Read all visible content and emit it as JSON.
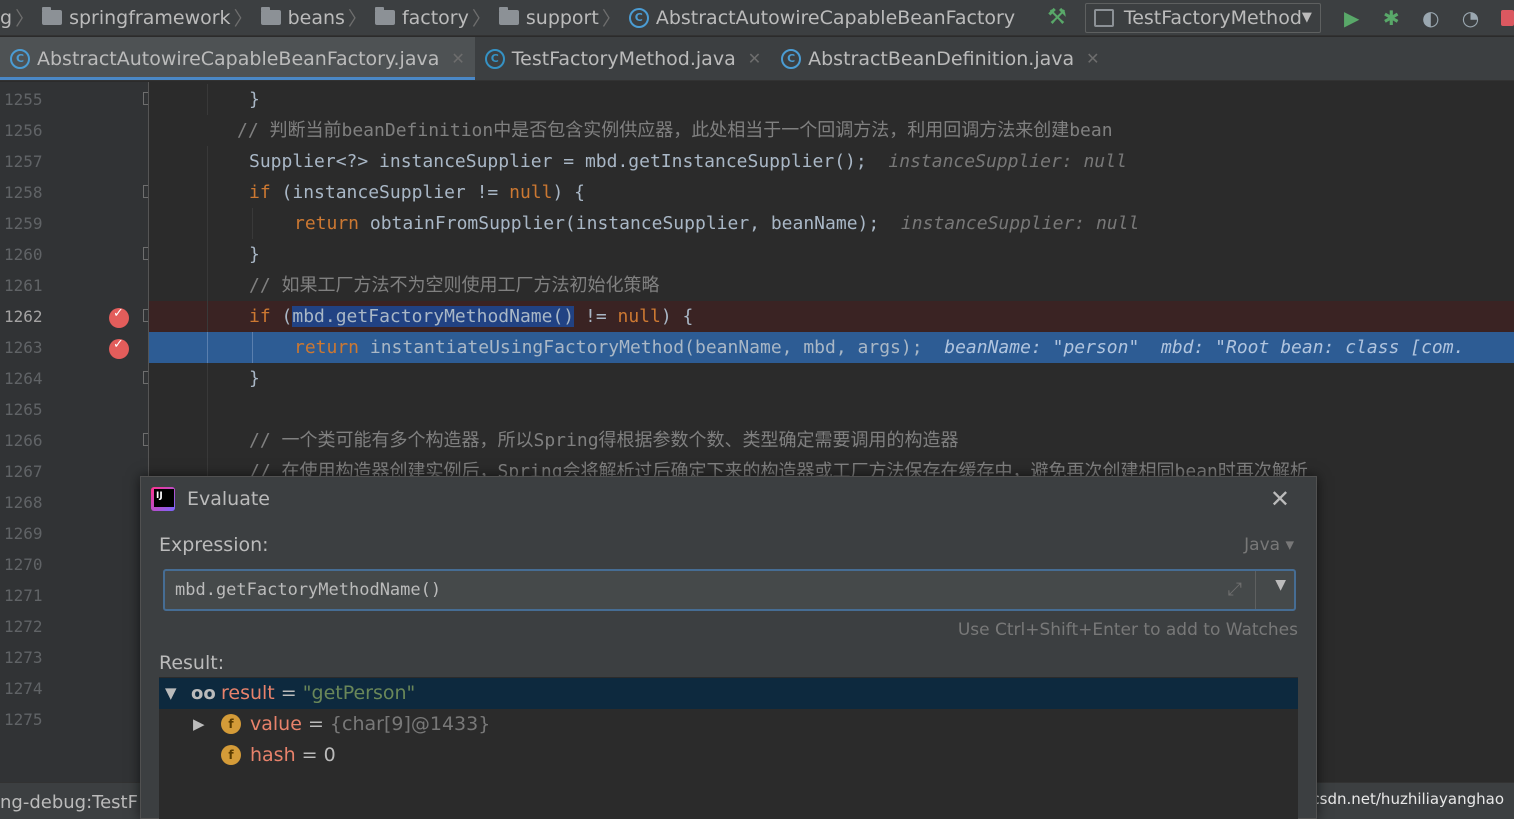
{
  "breadcrumb": [
    {
      "label": "g",
      "icon": "none"
    },
    {
      "label": "springframework",
      "icon": "folder-icon"
    },
    {
      "label": "beans",
      "icon": "folder-icon"
    },
    {
      "label": "factory",
      "icon": "folder-icon"
    },
    {
      "label": "support",
      "icon": "folder-icon"
    },
    {
      "label": "AbstractAutowireCapableBeanFactory",
      "icon": "class-icon"
    }
  ],
  "toolbar": {
    "run_config": "TestFactoryMethod",
    "buttons": [
      "build-icon",
      "run-icon",
      "debug-icon",
      "coverage-icon",
      "profile-icon",
      "stop-icon"
    ]
  },
  "tabs": [
    {
      "label": "AbstractAutowireCapableBeanFactory.java",
      "active": true
    },
    {
      "label": "TestFactoryMethod.java",
      "active": false
    },
    {
      "label": "AbstractBeanDefinition.java",
      "active": false
    }
  ],
  "editor": {
    "line_numbers": [
      "1255",
      "1256",
      "1257",
      "1258",
      "1259",
      "1260",
      "1261",
      "1262",
      "1263",
      "1264",
      "1265",
      "1266",
      "1267",
      "1268",
      "1269",
      "1270",
      "1271",
      "1272",
      "1273",
      "1274",
      "1275"
    ],
    "code": {
      "l1255": "}",
      "l1256": "// 判断当前beanDefinition中是否包含实例供应器，此处相当于一个回调方法，利用回调方法来创建bean",
      "l1257_code": "Supplier<?> instanceSupplier = mbd.getInstanceSupplier();",
      "l1257_hint": "instanceSupplier: null",
      "l1258_kw": "if",
      "l1258_a": " (instanceSupplier != ",
      "l1258_null": "null",
      "l1258_b": ") {",
      "l1259_kw": "return",
      "l1259_code": " obtainFromSupplier(instanceSupplier, beanName);",
      "l1259_hint": "instanceSupplier: null",
      "l1260": "}",
      "l1261": "// 如果工厂方法不为空则使用工厂方法初始化策略",
      "l1262_kw": "if",
      "l1262_a": " (",
      "l1262_sel": "mbd.getFactoryMethodName()",
      "l1262_b": " != ",
      "l1262_null": "null",
      "l1262_c": ") {",
      "l1263_kw": "return",
      "l1263_code": " instantiateUsingFactoryMethod(beanName, mbd, args);",
      "l1263_hint": "beanName: \"person\"  mbd: \"Root bean: class [com.",
      "l1264": "}",
      "l1266": "// 一个类可能有多个构造器，所以Spring得根据参数个数、类型确定需要调用的构造器",
      "l1267": "// 在使用构造器创建实例后，Spring会将解析过后确定下来的构造器或工厂方法保存在缓存中，避免再次创建相同bean时再次解析"
    }
  },
  "status_text": "ng-debug:TestF",
  "watermark": "https://blog.csdn.net/huzhiliayanghao",
  "evaluate": {
    "title": "Evaluate",
    "expression_label": "Expression:",
    "language": "Java",
    "expression": "mbd.getFactoryMethodName()",
    "watch_hint": "Use Ctrl+Shift+Enter to add to Watches",
    "result_label": "Result:",
    "result": {
      "name": "result",
      "eq": " = ",
      "value": "\"getPerson\""
    },
    "children": [
      {
        "name": "value",
        "eq": " = ",
        "value": "{char[9]@1433}",
        "expandable": true
      },
      {
        "name": "hash",
        "eq": " = ",
        "value": "0",
        "expandable": false
      }
    ]
  },
  "colors": {
    "background": "#2b2b2b",
    "execution_line": "#2d5c94",
    "breakpoint": "#e35d5b",
    "keyword": "#cc7832",
    "string": "#6a8759"
  }
}
